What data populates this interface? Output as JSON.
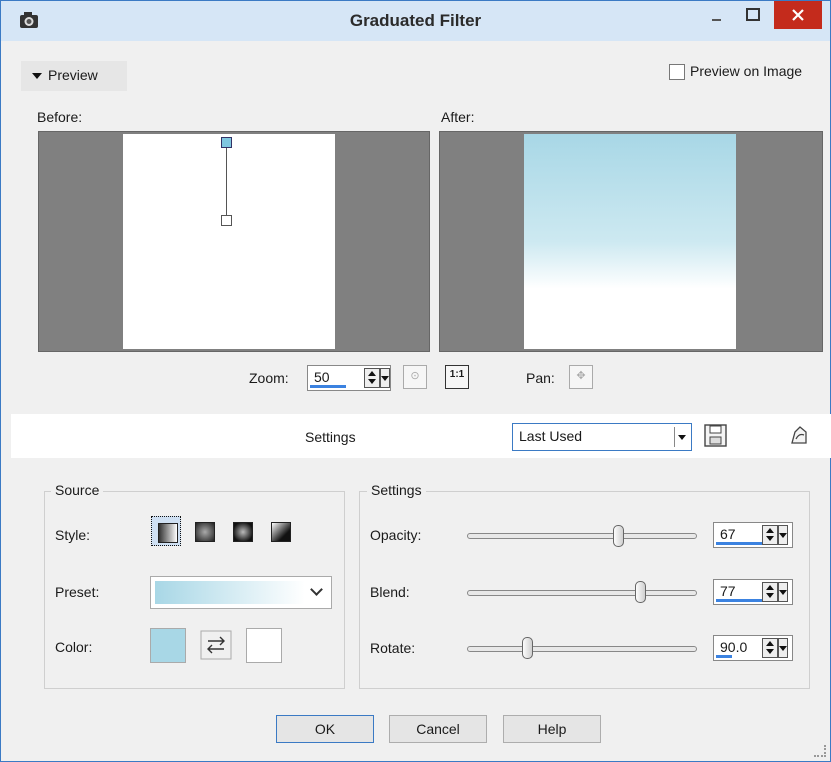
{
  "window": {
    "title": "Graduated Filter"
  },
  "preview": {
    "toggle_label": "Preview",
    "preview_on_image_label": "Preview on Image",
    "preview_on_image_checked": false,
    "before_label": "Before:",
    "after_label": "After:",
    "zoom_label": "Zoom:",
    "zoom_value": "50",
    "pan_label": "Pan:"
  },
  "presets_bar": {
    "settings_label": "Settings",
    "preset_value": "Last Used"
  },
  "source": {
    "group_title": "Source",
    "style_label": "Style:",
    "style_options": [
      "linear",
      "rectangular",
      "radial",
      "corner"
    ],
    "style_selected": "linear",
    "preset_label": "Preset:",
    "color_label": "Color:",
    "foreground_color": "#a8d7e6",
    "background_color": "#ffffff"
  },
  "settings": {
    "group_title": "Settings",
    "opacity": {
      "label": "Opacity:",
      "value": "67",
      "min": 0,
      "max": 100
    },
    "blend": {
      "label": "Blend:",
      "value": "77",
      "min": 0,
      "max": 100
    },
    "rotate": {
      "label": "Rotate:",
      "value": "90.0",
      "min": 0,
      "max": 360
    }
  },
  "buttons": {
    "ok": "OK",
    "cancel": "Cancel",
    "help": "Help"
  },
  "colors": {
    "accent": "#3b7ac4",
    "titlebar": "#d6e6f6",
    "close": "#c42b1c",
    "gradient_start": "#a8d7e6"
  }
}
